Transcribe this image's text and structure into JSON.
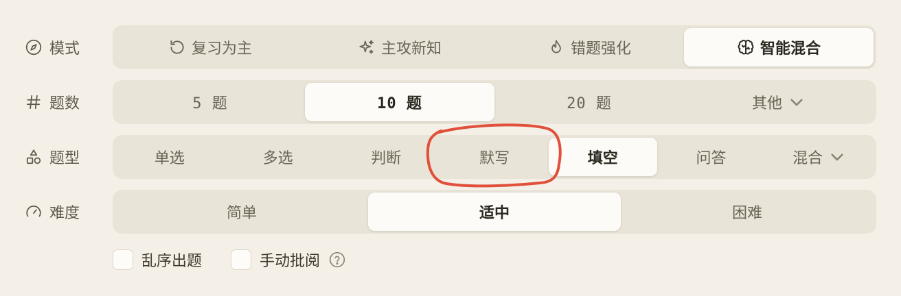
{
  "mode": {
    "label": "模式",
    "icon": "compass-icon",
    "options": [
      {
        "label": "复习为主",
        "icon": "rotate-ccw-icon",
        "active": false
      },
      {
        "label": "主攻新知",
        "icon": "sparkles-icon",
        "active": false
      },
      {
        "label": "错题强化",
        "icon": "flame-icon",
        "active": false
      },
      {
        "label": "智能混合",
        "icon": "brain-icon",
        "active": true
      }
    ]
  },
  "count": {
    "label": "题数",
    "icon": "hash-icon",
    "options": [
      {
        "label": "5 题",
        "active": false
      },
      {
        "label": "10 题",
        "active": true
      },
      {
        "label": "20 题",
        "active": false
      },
      {
        "label": "其他",
        "active": false,
        "dropdown": true
      }
    ]
  },
  "type": {
    "label": "题型",
    "icon": "shapes-icon",
    "options": [
      {
        "label": "单选",
        "active": false
      },
      {
        "label": "多选",
        "active": false
      },
      {
        "label": "判断",
        "active": false
      },
      {
        "label": "默写",
        "active": false
      },
      {
        "label": "填空",
        "active": true
      },
      {
        "label": "问答",
        "active": false
      },
      {
        "label": "混合",
        "active": false,
        "dropdown": true
      }
    ]
  },
  "difficulty": {
    "label": "难度",
    "icon": "gauge-icon",
    "options": [
      {
        "label": "简单",
        "active": false
      },
      {
        "label": "适中",
        "active": true
      },
      {
        "label": "困难",
        "active": false
      }
    ]
  },
  "options": {
    "shuffle": {
      "label": "乱序出题",
      "checked": false
    },
    "manual_review": {
      "label": "手动批阅",
      "checked": false,
      "help_icon": "help-circle-icon"
    }
  },
  "colors": {
    "background": "#f4f0e7",
    "track": "#e9e4d8",
    "active_segment": "#fcfbf7",
    "annotation": "#e0503a"
  }
}
